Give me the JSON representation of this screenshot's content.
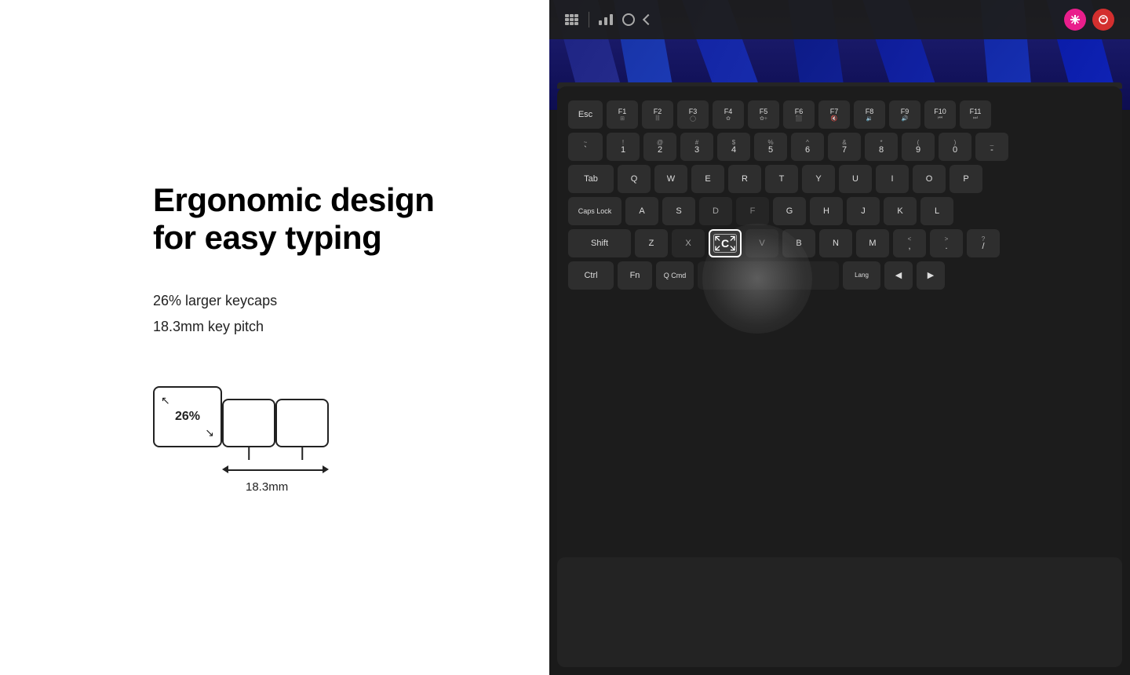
{
  "left": {
    "title_line1": "Ergonomic design",
    "title_line2": "for easy typing",
    "features": [
      "26% larger keycaps",
      "18.3mm key pitch"
    ],
    "diagram": {
      "percent_label": "26%",
      "pitch_label": "18.3mm"
    }
  },
  "right": {
    "status_bar": {
      "app_icons": [
        "snowflake-app-icon",
        "food-app-icon"
      ]
    },
    "keyboard": {
      "caps_lock_label": "Caps Lock",
      "highlighted_key": "C",
      "rows": [
        [
          "Esc",
          "F1",
          "F2",
          "F3",
          "F4",
          "F5",
          "F6",
          "F7",
          "F8",
          "F9",
          "F10",
          "F11"
        ],
        [
          "~`",
          "!1",
          "@2",
          "#3",
          "$4",
          "%5",
          "^6",
          "&7",
          "*8",
          "(9",
          ")0",
          "-_"
        ],
        [
          "Tab",
          "Q",
          "W",
          "E",
          "R",
          "T",
          "Y",
          "U",
          "I",
          "O",
          "P"
        ],
        [
          "Caps Lock",
          "A",
          "S",
          "D",
          "F",
          "G",
          "H",
          "J",
          "K",
          "L"
        ],
        [
          "Shift",
          "Z",
          "X",
          "C",
          "V",
          "B",
          "N",
          "M",
          "<,",
          ">.",
          "/"
        ],
        [
          "Ctrl",
          "Fn",
          "Cmd",
          "",
          "",
          "",
          "",
          "",
          "Lang",
          "◀",
          "▶"
        ]
      ]
    }
  }
}
